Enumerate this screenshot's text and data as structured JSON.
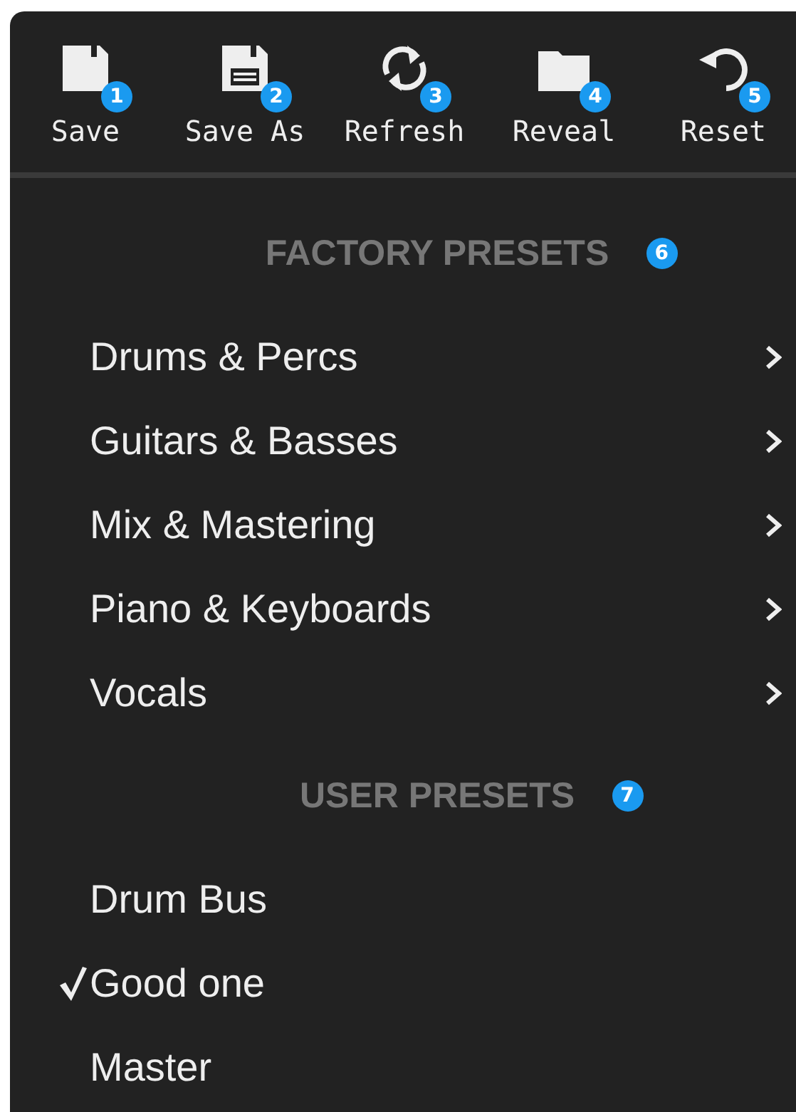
{
  "toolbar": {
    "buttons": [
      {
        "label": "Save",
        "kind": "save",
        "badge": "1"
      },
      {
        "label": "Save As",
        "kind": "save_as",
        "badge": "2"
      },
      {
        "label": "Refresh",
        "kind": "refresh",
        "badge": "3"
      },
      {
        "label": "Reveal",
        "kind": "reveal",
        "badge": "4"
      },
      {
        "label": "Reset",
        "kind": "reset",
        "badge": "5"
      }
    ]
  },
  "sections": [
    {
      "title": "FACTORY PRESETS",
      "badge": "6",
      "items": [
        {
          "label": "Drums & Percs",
          "submenu": true,
          "checked": false
        },
        {
          "label": "Guitars & Basses",
          "submenu": true,
          "checked": false
        },
        {
          "label": "Mix & Mastering",
          "submenu": true,
          "checked": false
        },
        {
          "label": "Piano & Keyboards",
          "submenu": true,
          "checked": false
        },
        {
          "label": "Vocals",
          "submenu": true,
          "checked": false
        }
      ]
    },
    {
      "title": "USER PRESETS",
      "badge": "7",
      "items": [
        {
          "label": "Drum Bus",
          "submenu": false,
          "checked": false
        },
        {
          "label": "Good one",
          "submenu": false,
          "checked": true
        },
        {
          "label": "Master",
          "submenu": false,
          "checked": false
        }
      ]
    }
  ]
}
